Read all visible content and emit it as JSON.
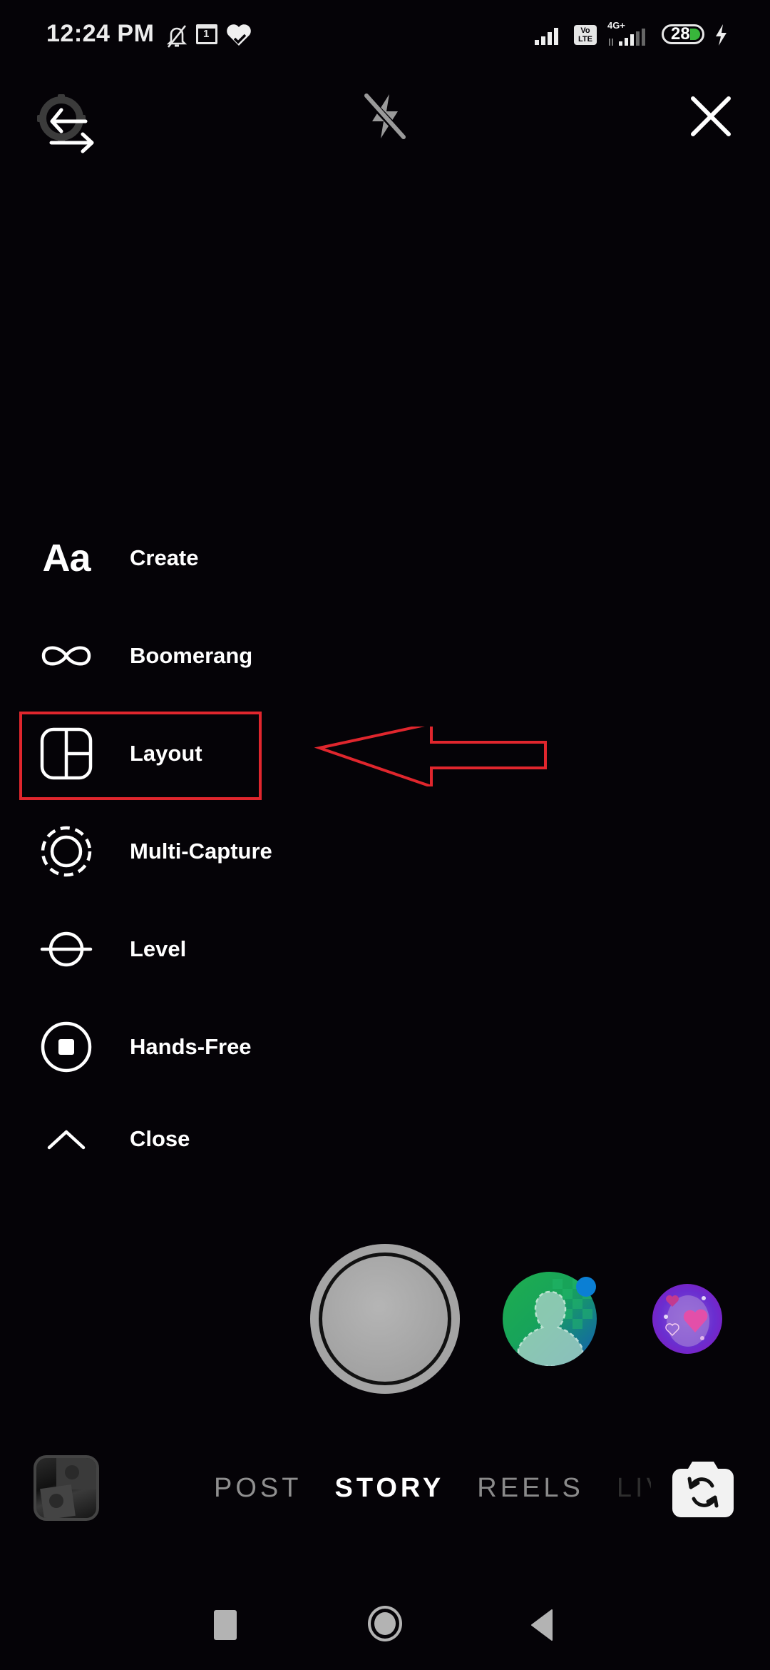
{
  "status_bar": {
    "time": "12:24 PM",
    "icons": [
      "notifications-muted-icon",
      "calendar-icon",
      "health-heart-icon"
    ],
    "calendar_day": "1",
    "network_label": "4G+",
    "volte_label_top": "Vo",
    "volte_label_bottom": "LTE",
    "battery_level": "28",
    "charging": true
  },
  "top_controls": {
    "settings": "camera-settings-icon",
    "flash": "flash-off-icon",
    "close": "close-icon"
  },
  "menu": {
    "items": [
      {
        "label": "Create",
        "icon": "text-aa-icon"
      },
      {
        "label": "Boomerang",
        "icon": "infinity-icon"
      },
      {
        "label": "Layout",
        "icon": "layout-grid-icon"
      },
      {
        "label": "Multi-Capture",
        "icon": "multi-capture-icon"
      },
      {
        "label": "Level",
        "icon": "level-icon"
      },
      {
        "label": "Hands-Free",
        "icon": "hands-free-icon"
      },
      {
        "label": "Close",
        "icon": "chevron-up-icon"
      }
    ],
    "highlighted": "Layout",
    "annotation_color": "#e0262d"
  },
  "capture": {
    "shutter": "shutter-button",
    "effects": [
      "avatar-effect",
      "hearts-effect"
    ]
  },
  "modes": {
    "items": [
      "POST",
      "STORY",
      "REELS",
      "LIVE"
    ],
    "selected": "STORY"
  },
  "colors": {
    "background": "#050307",
    "avatar_badge": "#0b7fd4",
    "battery_fill": "#38b63b"
  }
}
